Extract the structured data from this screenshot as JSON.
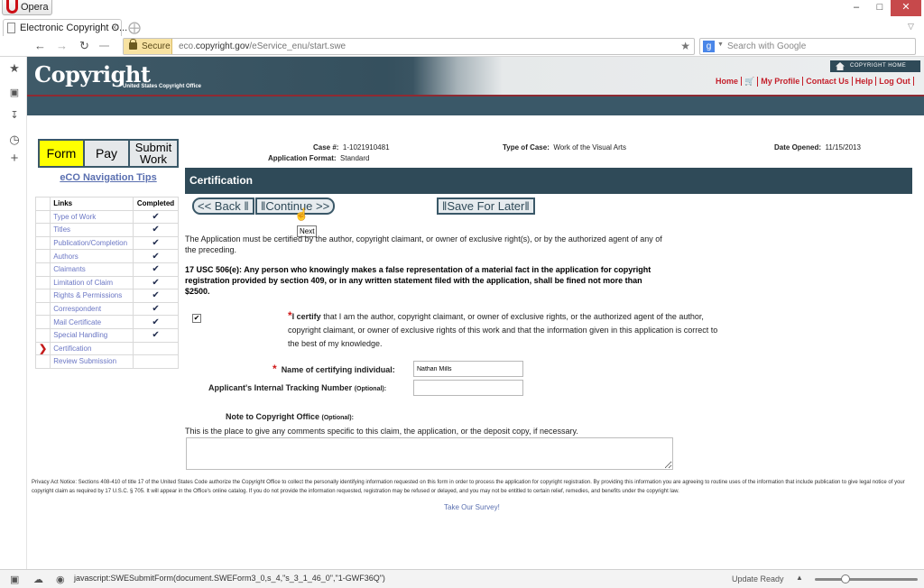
{
  "browser": {
    "menu_label": "Opera",
    "tab_title": "Electronic Copyright O...",
    "secure_label": "Secure",
    "url_host_pre": "eco.",
    "url_host": "copyright.gov",
    "url_path": "/eService_enu/start.swe",
    "search_placeholder": "Search with Google",
    "status_text": "javascript:SWESubmitForm(document.SWEForm3_0,s_4,\"s_3_1_46_0\",\"1-GWF36Q\")",
    "update_label": "Update Ready",
    "zoom_slider_fraction": 0.28
  },
  "site": {
    "logo": "Copyright",
    "logo_sub": "United States Copyright Office",
    "copyright_home": "COPYRIGHT HOME",
    "top_links": [
      "Home",
      "My Profile",
      "Contact Us",
      "Help",
      "Log Out"
    ]
  },
  "nav": {
    "steps": [
      {
        "label": "Form",
        "active": true
      },
      {
        "label": "Pay",
        "active": false
      },
      {
        "label": "Submit Work",
        "active": false
      }
    ],
    "tips_link": "eCO Navigation Tips",
    "col_links": "Links",
    "col_completed": "Completed",
    "items": [
      {
        "label": "Type of Work",
        "completed": true
      },
      {
        "label": "Titles",
        "completed": true
      },
      {
        "label": "Publication/Completion",
        "completed": true
      },
      {
        "label": "Authors",
        "completed": true
      },
      {
        "label": "Claimants",
        "completed": true
      },
      {
        "label": "Limitation of Claim",
        "completed": true
      },
      {
        "label": "Rights & Permissions",
        "completed": true
      },
      {
        "label": "Correspondent",
        "completed": true
      },
      {
        "label": "Mail Certificate",
        "completed": true
      },
      {
        "label": "Special Handling",
        "completed": true
      },
      {
        "label": "Certification",
        "completed": false,
        "current": true
      },
      {
        "label": "Review Submission",
        "completed": false
      }
    ]
  },
  "case": {
    "case_label": "Case #:",
    "case_value": "1-1021910481",
    "format_label": "Application Format:",
    "format_value": "Standard",
    "type_label": "Type of Case:",
    "type_value": "Work of the Visual Arts",
    "date_label": "Date Opened:",
    "date_value": "11/15/2013"
  },
  "section": {
    "title": "Certification",
    "back_label": "<< Back",
    "continue_label": "Continue >>",
    "save_label": "Save For Later",
    "tooltip": "Next",
    "intro": "The Application must be certified by the author, copyright claimant, or owner of exclusive right(s), or by the authorized agent of any of the preceding.",
    "warning": "17 USC 506(e): Any person who knowingly makes a false representation of a material fact in the application for copyright registration provided by section 409, or in any written statement filed with the application, shall be fined not more than $2500.",
    "certify_checked": true,
    "certify_bold": "I certify",
    "certify_text": " that I am the author, copyright claimant, or owner of exclusive rights, or the authorized agent of the author, copyright claimant, or owner of exclusive rights of this work and that the information given in this application is correct to the best of my knowledge.",
    "name_label": "Name of certifying individual:",
    "name_value": "Nathan Mills",
    "tracking_label": "Applicant's Internal Tracking Number",
    "optional": "(Optional):",
    "tracking_value": "",
    "note_label": "Note to Copyright Office",
    "note_help": "This is the place to give any comments specific to this claim, the application, or the deposit copy, if necessary.",
    "note_value": ""
  },
  "footer": {
    "privacy": "Privacy Act Notice: Sections 408-410 of title 17 of the United States Code authorize the Copyright Office to collect the personally identifying information requested on this form in order to process the application for copyright registration. By providing this information you are agreeing to routine uses of the information that include publication to give legal notice of your copyright claim as required by 17 U.S.C. § 705. It will appear in the Office's online catalog. If you do not provide the information requested, registration may be refused or delayed, and you may not be entitled to certain relief, remedies, and benefits under the copyright law.",
    "survey": "Take Our Survey!"
  }
}
